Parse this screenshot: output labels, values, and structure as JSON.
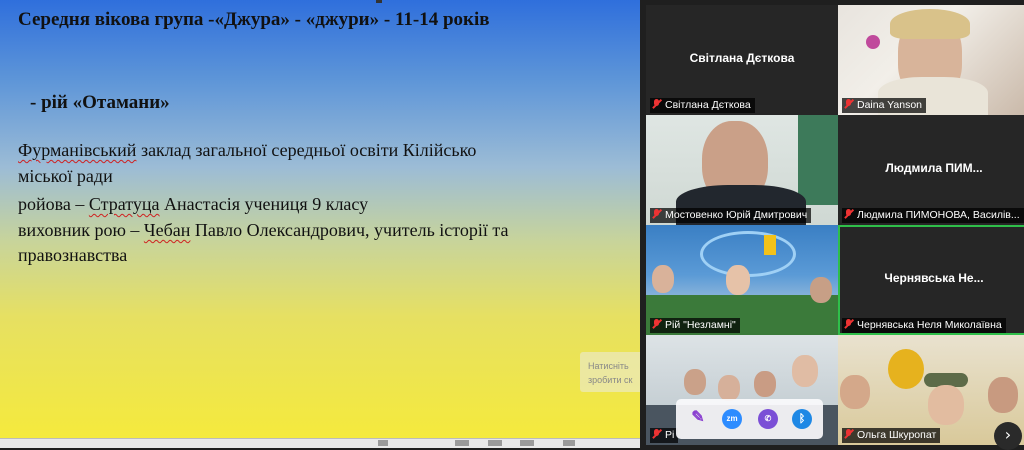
{
  "slide": {
    "title": "Середня вікова група -«Джура» - «джури» - 11-14 років",
    "subtitle": "- рій «Отамани»",
    "line1_a": "Фурманівський",
    "line1_b": " заклад  загальної  середньої  освіти  Кілійсько",
    "line2": "міської ради",
    "line3_a": "ройова – ",
    "line3_b": "Стратуца",
    "line3_c": " Анастасія учениця 9 класу",
    "line4_a": "виховник  рою  –  ",
    "line4_b": "Чебан",
    "line4_c": "  Павло  Олександрович,  учитель  історії  та",
    "line5": "правознавства"
  },
  "tooltip": {
    "line1": "Натисніть",
    "line2": "зробити ск"
  },
  "participants": [
    {
      "center": "Світлана Дєткова",
      "label": "Світлана Дєткова"
    },
    {
      "label": "Daina Yanson"
    },
    {
      "label": "Мостовенко Юрій Дмитрович"
    },
    {
      "center": "Людмила  ПИМ...",
      "label": "Людмила ПИМОНОВА, Василів..."
    },
    {
      "label": "Рій \"Незламні\""
    },
    {
      "center": "Чернявська  Не...",
      "label": "Чернявська Неля Миколаївна"
    },
    {
      "label": "Рі"
    },
    {
      "label": "Ольга Шкуропат"
    }
  ],
  "toolbar": {
    "zoom_label": "zm"
  },
  "colors": {
    "active_speaker": "#2fbf4a",
    "muted": "#e33333",
    "tile_bg": "#262626"
  }
}
